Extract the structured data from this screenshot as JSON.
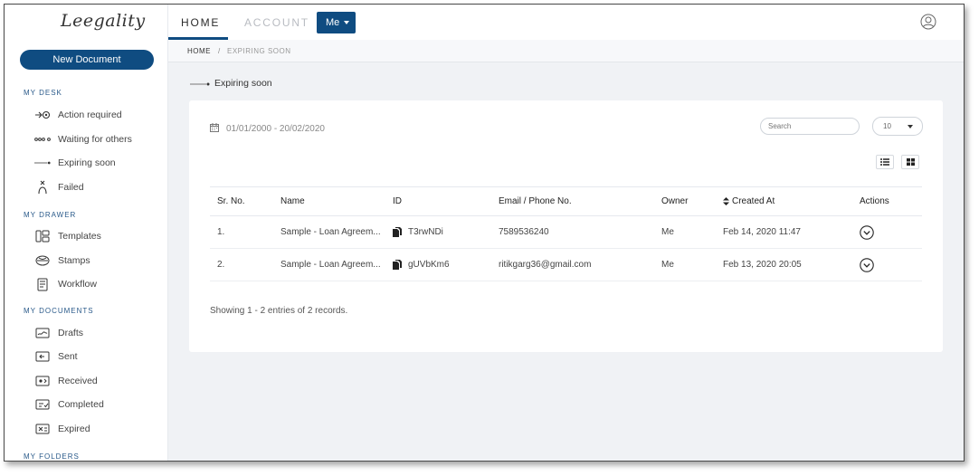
{
  "app": {
    "logo_text": "Leegality"
  },
  "sidebar": {
    "new_document": "New Document",
    "sections": [
      {
        "title": "MY DESK",
        "items": [
          {
            "label": "Action required",
            "icon": "action-required-icon"
          },
          {
            "label": "Waiting for others",
            "icon": "waiting-icon"
          },
          {
            "label": "Expiring soon",
            "icon": "expiring-icon"
          },
          {
            "label": "Failed",
            "icon": "failed-icon"
          }
        ]
      },
      {
        "title": "MY DRAWER",
        "items": [
          {
            "label": "Templates",
            "icon": "templates-icon"
          },
          {
            "label": "Stamps",
            "icon": "stamps-icon"
          },
          {
            "label": "Workflow",
            "icon": "workflow-icon"
          }
        ]
      },
      {
        "title": "MY DOCUMENTS",
        "items": [
          {
            "label": "Drafts",
            "icon": "drafts-icon"
          },
          {
            "label": "Sent",
            "icon": "sent-icon"
          },
          {
            "label": "Received",
            "icon": "received-icon"
          },
          {
            "label": "Completed",
            "icon": "completed-icon"
          },
          {
            "label": "Expired",
            "icon": "expired-icon"
          }
        ]
      },
      {
        "title": "MY FOLDERS",
        "items": []
      }
    ]
  },
  "topbar": {
    "tabs": [
      {
        "label": "HOME",
        "active": true
      },
      {
        "label": "ACCOUNT",
        "active": false
      }
    ],
    "me_button": "Me",
    "accent": "#0f4c81"
  },
  "breadcrumb": {
    "home": "HOME",
    "separator": "/",
    "current": "EXPIRING SOON"
  },
  "page": {
    "title": "Expiring soon"
  },
  "filters": {
    "date_range": "01/01/2000 - 20/02/2020",
    "search_placeholder": "Search",
    "page_size": "10"
  },
  "table": {
    "columns": [
      "Sr. No.",
      "Name",
      "ID",
      "Email / Phone No.",
      "Owner",
      "Created At",
      "Actions"
    ],
    "rows": [
      {
        "sr": "1.",
        "name": "Sample - Loan Agreem...",
        "id": "T3rwNDi",
        "email": "7589536240",
        "owner": "Me",
        "created": "Feb 14, 2020 11:47"
      },
      {
        "sr": "2.",
        "name": "Sample - Loan Agreem...",
        "id": "gUVbKm6",
        "email": "ritikgarg36@gmail.com",
        "owner": "Me",
        "created": "Feb 13, 2020 20:05"
      }
    ],
    "footer": "Showing 1 - 2 entries of 2 records."
  }
}
